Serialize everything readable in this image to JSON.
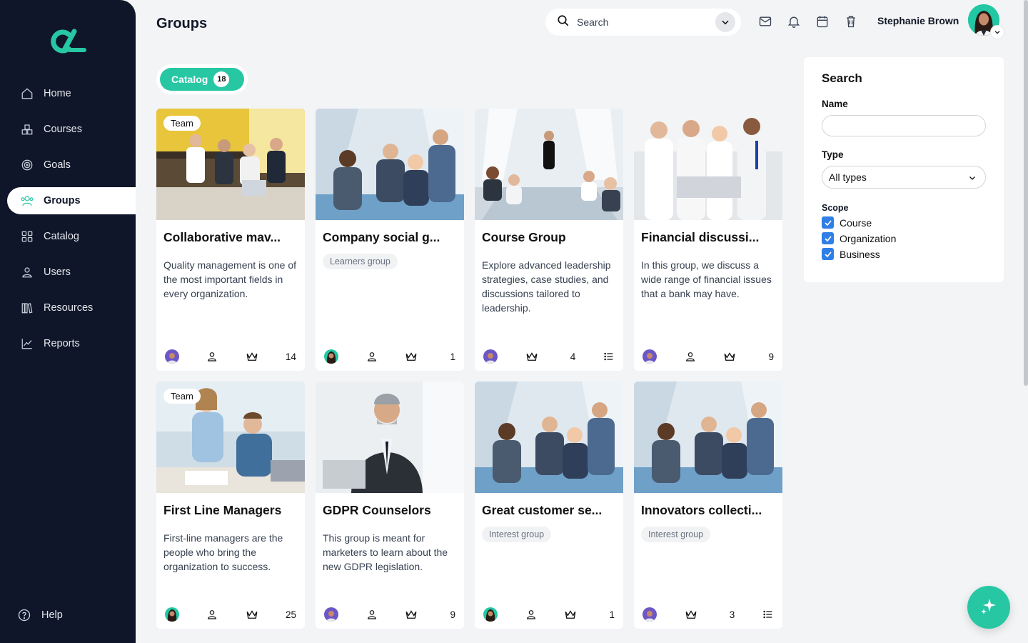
{
  "app": {
    "page_title": "Groups",
    "accent_color": "#27c7a3",
    "sidebar_bg": "#0f1629"
  },
  "sidebar": {
    "items": [
      {
        "label": "Home",
        "icon": "home-icon"
      },
      {
        "label": "Courses",
        "icon": "courses-icon"
      },
      {
        "label": "Goals",
        "icon": "target-icon"
      },
      {
        "label": "Groups",
        "icon": "users-group-icon",
        "active": true
      },
      {
        "label": "Catalog",
        "icon": "grid-icon"
      },
      {
        "label": "Users",
        "icon": "user-icon"
      },
      {
        "label": "Resources",
        "icon": "library-icon"
      },
      {
        "label": "Reports",
        "icon": "chart-line-icon"
      }
    ],
    "help_label": "Help"
  },
  "header": {
    "search_label": "Search",
    "user_name": "Stephanie Brown",
    "icons": [
      "mail-icon",
      "bell-icon",
      "calendar-icon",
      "trash-icon"
    ]
  },
  "catalog": {
    "label": "Catalog",
    "count": "18"
  },
  "cards": [
    {
      "title": "Collaborative mav...",
      "badge": "Team",
      "desc": "Quality management is one of the most important fields in every organization.",
      "chip": "",
      "count": "14",
      "icons": [
        "user-icon",
        "crown-icon"
      ]
    },
    {
      "title": "Company social g...",
      "badge": "",
      "desc": "",
      "chip": "Learners group",
      "count": "1",
      "icons": [
        "user-icon",
        "crown-icon"
      ]
    },
    {
      "title": "Course Group",
      "badge": "",
      "desc": "Explore advanced leadership strategies, case studies, and discussions tailored to leadership.",
      "chip": "",
      "count": "4",
      "icons": [
        "crown-icon",
        "list-icon"
      ]
    },
    {
      "title": "Financial discussi...",
      "badge": "",
      "desc": "In this group, we discuss a wide range of financial issues that a bank may have.",
      "chip": "",
      "count": "9",
      "icons": [
        "user-icon",
        "crown-icon"
      ]
    },
    {
      "title": "First Line Managers",
      "badge": "Team",
      "desc": "First-line managers are the people who bring the organization to success.",
      "chip": "",
      "count": "25",
      "icons": [
        "user-icon",
        "crown-icon"
      ]
    },
    {
      "title": "GDPR Counselors",
      "badge": "",
      "desc": "This group is meant for marketers to learn about the new GDPR legislation.",
      "chip": "",
      "count": "9",
      "icons": [
        "user-icon",
        "crown-icon"
      ]
    },
    {
      "title": "Great customer se...",
      "badge": "",
      "desc": "",
      "chip": "Interest group",
      "count": "1",
      "icons": [
        "user-icon",
        "crown-icon"
      ]
    },
    {
      "title": "Innovators collecti...",
      "badge": "",
      "desc": "",
      "chip": "Interest group",
      "count": "3",
      "icons": [
        "crown-icon",
        "list-icon"
      ]
    }
  ],
  "filter_panel": {
    "heading": "Search",
    "name_label": "Name",
    "name_value": "",
    "type_label": "Type",
    "type_value": "All types",
    "scope_label": "Scope",
    "scope_options": [
      {
        "label": "Course",
        "checked": true
      },
      {
        "label": "Organization",
        "checked": true
      },
      {
        "label": "Business",
        "checked": true
      }
    ]
  },
  "fab": {
    "icon": "sparkle-icon"
  }
}
